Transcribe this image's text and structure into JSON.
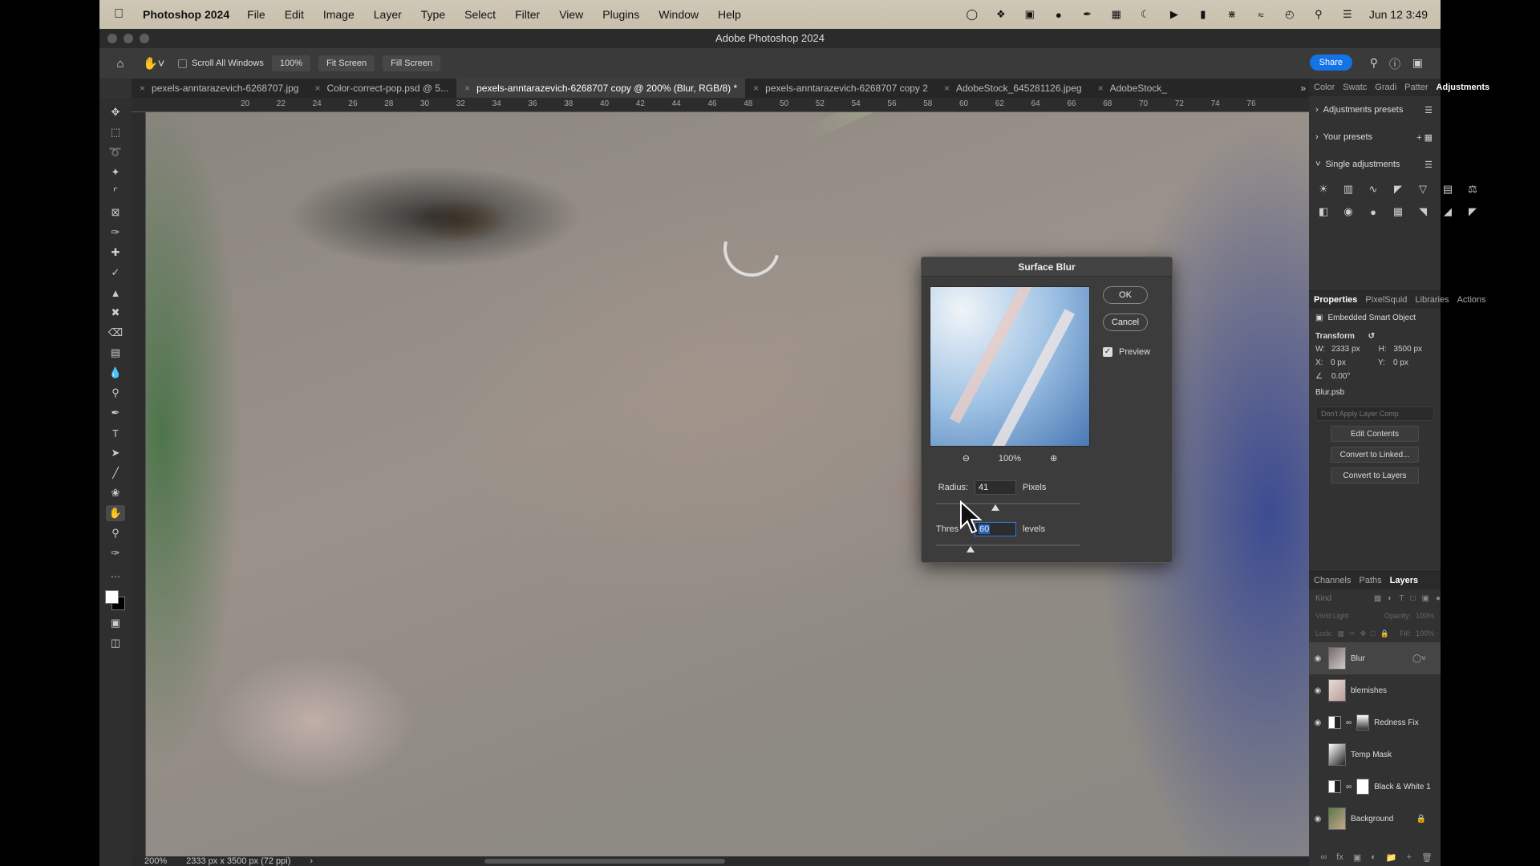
{
  "menubar": {
    "app_name": "Photoshop 2024",
    "menus": [
      "File",
      "Edit",
      "Image",
      "Layer",
      "Type",
      "Select",
      "Filter",
      "View",
      "Plugins",
      "Window",
      "Help"
    ],
    "date_time": "Jun 12  3:49"
  },
  "window": {
    "title": "Adobe Photoshop 2024"
  },
  "options": {
    "scroll_all_windows": "Scroll All Windows",
    "zoom": "100%",
    "fit_screen": "Fit Screen",
    "fill_screen": "Fill Screen",
    "share": "Share"
  },
  "tabs": [
    {
      "label": "pexels-anntarazevich-6268707.jpg"
    },
    {
      "label": "Color-correct-pop.psd @ 5..."
    },
    {
      "label": "pexels-anntarazevich-6268707 copy @ 200% (Blur, RGB/8) *"
    },
    {
      "label": "pexels-anntarazevich-6268707 copy 2"
    },
    {
      "label": "AdobeStock_645281126.jpeg"
    },
    {
      "label": "AdobeStock_"
    }
  ],
  "ruler_numbers": [
    "20",
    "22",
    "24",
    "26",
    "28",
    "30",
    "32",
    "34",
    "36",
    "38",
    "40",
    "42",
    "44",
    "46",
    "48",
    "50",
    "52",
    "54",
    "56",
    "58",
    "60",
    "62",
    "64",
    "66",
    "68",
    "70",
    "72",
    "74",
    "76"
  ],
  "status": {
    "zoom": "200%",
    "doc_size": "2333 px x 3500 px (72 ppi)"
  },
  "panel_tabs_top": [
    "Color",
    "Swatc",
    "Gradi",
    "Patter",
    "Adjustments"
  ],
  "adjustments": {
    "presets": "Adjustments presets",
    "your_presets": "Your presets",
    "single": "Single adjustments"
  },
  "panel_tabs_mid": [
    "Properties",
    "PixelSquid",
    "Libraries",
    "Actions"
  ],
  "properties": {
    "object_type": "Embedded Smart Object",
    "transform_label": "Transform",
    "w": "2333 px",
    "h": "3500 px",
    "x": "0 px",
    "y": "0 px",
    "angle": "0.00°",
    "file_name": "Blur.psb",
    "layer_comp": "Don't Apply Layer Comp",
    "edit_contents": "Edit Contents",
    "convert_linked": "Convert to Linked...",
    "convert_layers": "Convert to Layers"
  },
  "panel_tabs_bottom": [
    "Channels",
    "Paths",
    "Layers"
  ],
  "layers_panel": {
    "kind": "Kind",
    "blend_mode": "Vivid Light",
    "opacity_label": "Opacity:",
    "opacity": "100%",
    "lock_label": "Lock:",
    "fill_label": "Fill:",
    "fill": "100%"
  },
  "layers": [
    {
      "name": "Blur"
    },
    {
      "name": "blemishes"
    },
    {
      "name": "Redness Fix"
    },
    {
      "name": "Temp Mask"
    },
    {
      "name": "Black & White 1"
    },
    {
      "name": "Background"
    }
  ],
  "dialog": {
    "title": "Surface Blur",
    "ok": "OK",
    "cancel": "Cancel",
    "preview": "Preview",
    "preview_zoom": "100%",
    "radius_label": "Radius:",
    "radius_value": "41",
    "radius_unit": "Pixels",
    "threshold_label": "Thres",
    "threshold_label_tail": ":",
    "threshold_value": "60",
    "threshold_unit": "levels",
    "radius_fraction": 0.41,
    "threshold_fraction": 0.24
  }
}
